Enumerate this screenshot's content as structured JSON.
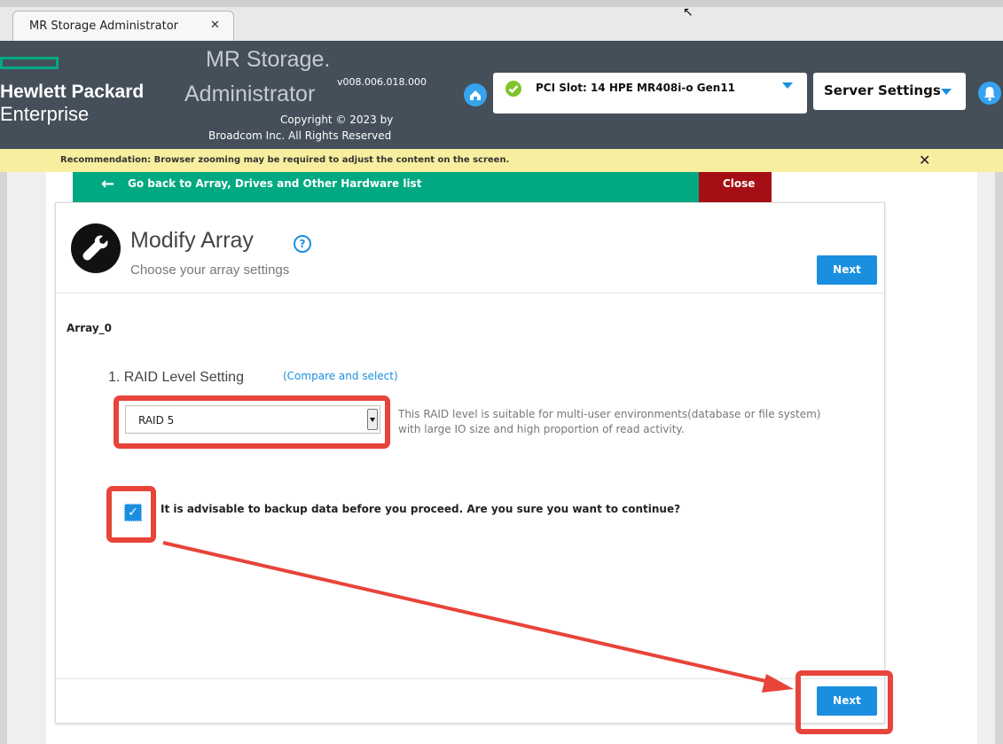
{
  "browser": {
    "tab_title": "MR Storage Administrator",
    "tab_close": "✕",
    "cursor": "↖"
  },
  "header": {
    "brand_line1": "Hewlett Packard",
    "brand_line2": "Enterprise",
    "app_name_line1": "MR Storage.",
    "app_name_line2": "Administrator",
    "version": "v008.006.018.000",
    "copyright_line1": "Copyright © 2023 by",
    "copyright_line2": "Broadcom Inc. All Rights Reserved",
    "controller_select": "PCI Slot: 14 HPE MR408i-o Gen11",
    "server_settings": "Server Settings",
    "icons": [
      "home-icon",
      "check-circle-icon",
      "bell-icon"
    ]
  },
  "recommendation": {
    "text": "Recommendation: Browser zooming may be required to adjust the content on the screen.",
    "close": "✕"
  },
  "nav": {
    "back_arrow": "←",
    "back_label": "Go back to Array, Drives and Other Hardware list",
    "close_label": "Close"
  },
  "card": {
    "title": "Modify Array",
    "help": "?",
    "subtitle": "Choose your array settings",
    "next_label": "Next",
    "array_name": "Array_0",
    "raid_label": "1. RAID Level Setting",
    "compare_link": "(Compare and select)",
    "raid_value": "RAID 5",
    "raid_description": "This RAID level is suitable for multi-user environments(database or file system) with large IO size and high proportion of read activity.",
    "confirm_checked": true,
    "confirm_check": "✓",
    "confirm_text": "It is advisable to backup data before you proceed. Are you sure you want to continue?",
    "next_bottom_label": "Next"
  },
  "colors": {
    "header_bg": "#444f59",
    "hpe_green": "#01a982",
    "close_red": "#a50f13",
    "accent_blue": "#1a8fe0",
    "recommendation_bg": "#f8ee9f",
    "annotation_red": "#e8443a"
  }
}
